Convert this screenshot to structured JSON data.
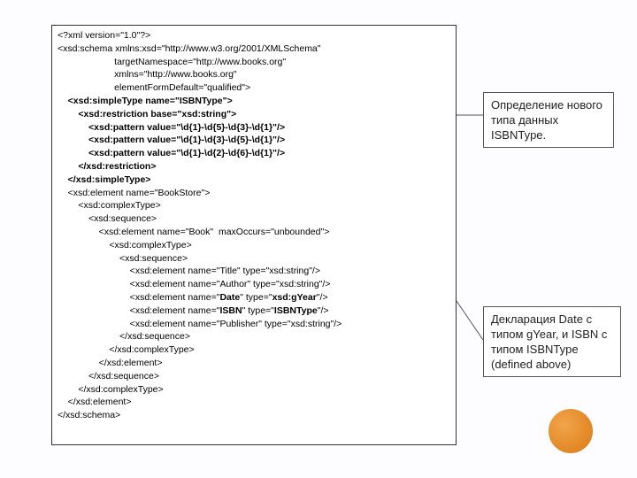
{
  "code": {
    "l01": "<?xml version=\"1.0\"?>",
    "l02": "<xsd:schema xmlns:xsd=\"http://www.w3.org/2001/XMLSchema\"",
    "l03": "                      targetNamespace=\"http://www.books.org\"",
    "l04": "                      xmlns=\"http://www.books.org\"",
    "l05": "                      elementFormDefault=\"qualified\">",
    "l06": "    <xsd:simpleType name=\"ISBNType\">",
    "l07": "        <xsd:restriction base=\"xsd:string\">",
    "l08": "            <xsd:pattern value=\"\\d{1}-\\d{5}-\\d{3}-\\d{1}\"/>",
    "l09": "            <xsd:pattern value=\"\\d{1}-\\d{3}-\\d{5}-\\d{1}\"/>",
    "l10": "            <xsd:pattern value=\"\\d{1}-\\d{2}-\\d{6}-\\d{1}\"/>",
    "l11": "        </xsd:restriction>",
    "l12": "    </xsd:simpleType>",
    "l13": "    <xsd:element name=\"BookStore\">",
    "l14": "        <xsd:complexType>",
    "l15": "            <xsd:sequence>",
    "l16": "                <xsd:element name=\"Book\"  maxOccurs=\"unbounded\">",
    "l17": "                    <xsd:complexType>",
    "l18": "                        <xsd:sequence>",
    "l19": "                            <xsd:element name=\"Title\" type=\"xsd:string\"/>",
    "l20": "                            <xsd:element name=\"Author\" type=\"xsd:string\"/>",
    "l21a": "                            <xsd:element name=\"",
    "l21b": "Date",
    "l21c": "\" type=\"",
    "l21d": "xsd:gYear",
    "l21e": "\"/>",
    "l22a": "                            <xsd:element name=\"",
    "l22b": "ISBN",
    "l22c": "\" type=\"",
    "l22d": "ISBNType",
    "l22e": "\"/>",
    "l23": "                            <xsd:element name=\"Publisher\" type=\"xsd:string\"/>",
    "l24": "                        </xsd:sequence>",
    "l25": "                    </xsd:complexType>",
    "l26": "                </xsd:element>",
    "l27": "            </xsd:sequence>",
    "l28": "        </xsd:complexType>",
    "l29": "    </xsd:element>",
    "l30": "</xsd:schema>"
  },
  "callouts": {
    "c1": "Определение нового типа данных ISBNType.",
    "c2": "Декларация Date с типом gYear, и ISBN с типом ISBNType (defined above)"
  }
}
